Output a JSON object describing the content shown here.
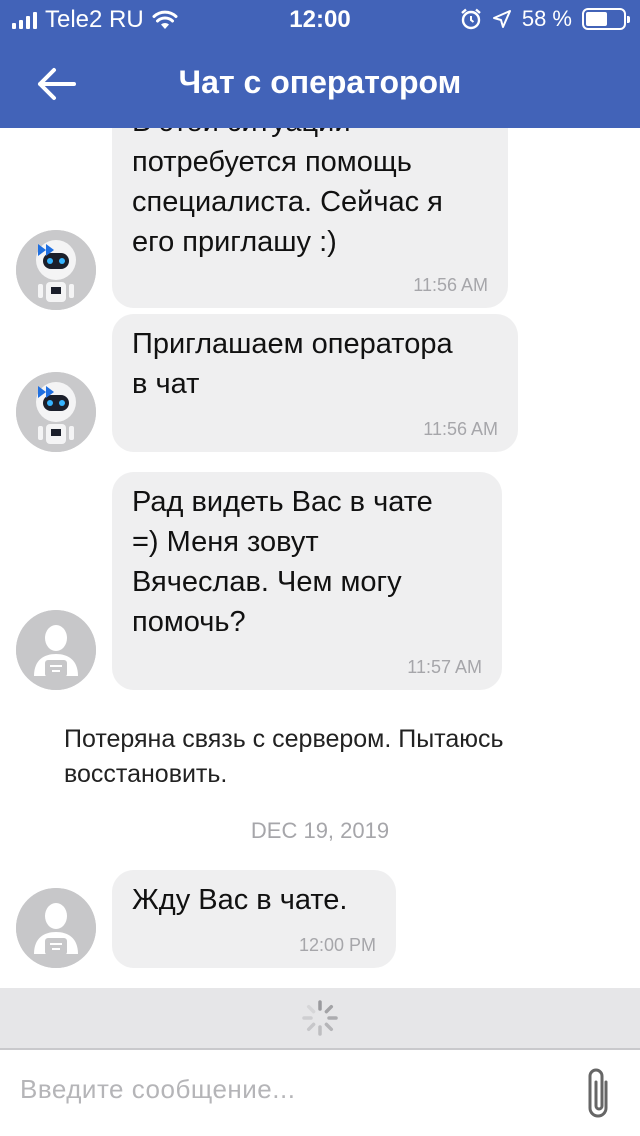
{
  "status_bar": {
    "carrier": "Tele2 RU",
    "time": "12:00",
    "battery_percent": "58 %",
    "battery_level": 0.58,
    "icons": [
      "signal-icon",
      "wifi-icon",
      "alarm-icon",
      "location-icon",
      "battery-icon"
    ]
  },
  "header": {
    "title": "Чат с оператором",
    "back_icon": "arrow-left-icon",
    "background": "#4263b8"
  },
  "messages": [
    {
      "sender": "bot",
      "text": "В этой ситуации\nпотребуется помощь\nспециалиста. Сейчас я\nего приглашу :)",
      "time": "11:56 AM"
    },
    {
      "sender": "bot",
      "text": "Приглашаем оператора\nв чат",
      "time": "11:56 AM"
    },
    {
      "sender": "operator",
      "text": "Рад видеть Вас в чате\n=) Меня зовут\nВячеслав. Чем могу\nпомочь?",
      "time": "11:57 AM"
    },
    {
      "sender": "operator",
      "text": "Жду Вас в чате.",
      "time": "12:00 PM"
    }
  ],
  "system_message": "Потеряна связь с сервером. Пытаюсь восстановить.",
  "date_separator": "DEC 19, 2019",
  "composer": {
    "placeholder": "Введите сообщение...",
    "attach_icon": "paperclip-icon",
    "loading_icon": "spinner-icon"
  }
}
